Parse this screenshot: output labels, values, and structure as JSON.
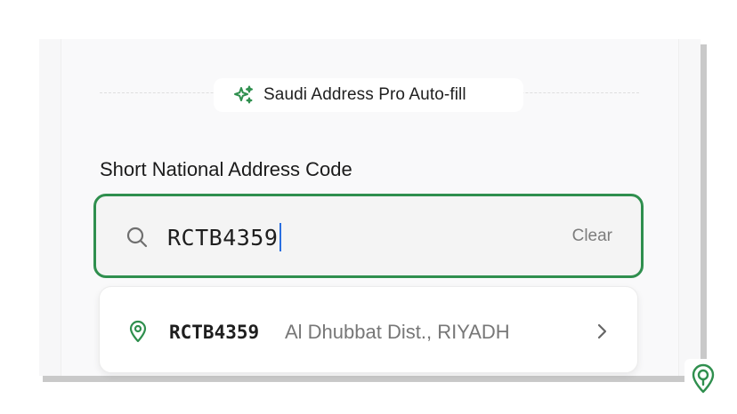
{
  "header": {
    "badge_label": "Saudi Address Pro Auto-fill",
    "badge_icon": "sparkles-icon"
  },
  "form": {
    "field_label": "Short National Address Code",
    "search": {
      "value": "RCTB4359",
      "clear_label": "Clear",
      "icon": "search-icon"
    }
  },
  "suggestions": [
    {
      "code": "RCTB4359",
      "description": "Al Dhubbat Dist., RIYADH",
      "icon": "location-pin-icon"
    }
  ],
  "colors": {
    "accent": "#2f8f4e",
    "caret": "#2a6fe0",
    "muted_text": "#777777"
  }
}
